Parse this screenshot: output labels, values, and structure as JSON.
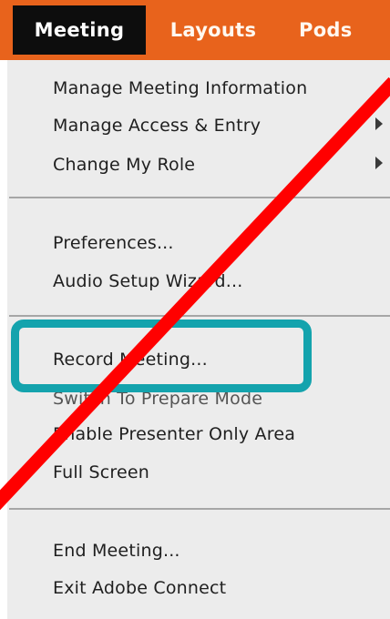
{
  "menubar": {
    "tabs": [
      {
        "label": "Meeting"
      },
      {
        "label": "Layouts"
      },
      {
        "label": "Pods"
      }
    ]
  },
  "menu": {
    "items": [
      {
        "label": "Manage Meeting Information"
      },
      {
        "label": "Manage Access & Entry",
        "has_submenu": true
      },
      {
        "label": "Change My Role",
        "has_submenu": true
      },
      {
        "label": "Preferences..."
      },
      {
        "label": "Audio Setup Wizard..."
      },
      {
        "label": "Record Meeting..."
      },
      {
        "label": "Switch To Prepare Mode"
      },
      {
        "label": "Enable Presenter Only Area"
      },
      {
        "label": "Full Screen"
      },
      {
        "label": "End Meeting..."
      },
      {
        "label": "Exit Adobe Connect"
      }
    ]
  },
  "colors": {
    "menubar_bg": "#e8631c",
    "active_tab_bg": "#0d0d0d",
    "menu_bg": "#ececec",
    "highlight_border": "#14a3ad",
    "strike_line": "#ff0000"
  }
}
